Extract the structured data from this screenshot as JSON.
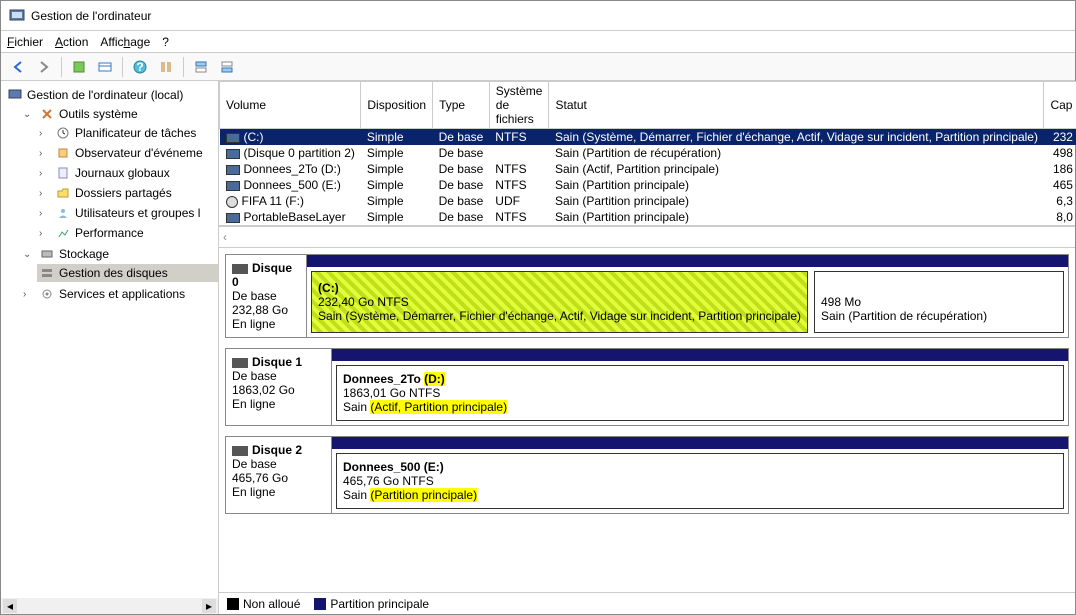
{
  "title": "Gestion de l'ordinateur",
  "menu": {
    "file": "Fichier",
    "action": "Action",
    "view": "Affichage",
    "help": "?"
  },
  "tree": {
    "root": "Gestion de l'ordinateur (local)",
    "sys": "Outils système",
    "sys_items": [
      "Planificateur de tâches",
      "Observateur d'événeme",
      "Journaux globaux",
      "Dossiers partagés",
      "Utilisateurs et groupes l",
      "Performance"
    ],
    "storage": "Stockage",
    "disks": "Gestion des disques",
    "services": "Services et applications"
  },
  "cols": {
    "volume": "Volume",
    "disposition": "Disposition",
    "type": "Type",
    "fs": "Système de fichiers",
    "status": "Statut",
    "cap": "Cap"
  },
  "rows": [
    {
      "name": "(C:)",
      "disp": "Simple",
      "type": "De base",
      "fs": "NTFS",
      "status": "Sain (Système, Démarrer, Fichier d'échange, Actif, Vidage sur incident, Partition principale)",
      "cap": "232"
    },
    {
      "name": "(Disque 0 partition 2)",
      "disp": "Simple",
      "type": "De base",
      "fs": "",
      "status": "Sain (Partition de récupération)",
      "cap": "498"
    },
    {
      "name": "Donnees_2To (D:)",
      "disp": "Simple",
      "type": "De base",
      "fs": "NTFS",
      "status": "Sain (Actif, Partition principale)",
      "cap": "186"
    },
    {
      "name": "Donnees_500 (E:)",
      "disp": "Simple",
      "type": "De base",
      "fs": "NTFS",
      "status": "Sain (Partition principale)",
      "cap": "465"
    },
    {
      "name": "FIFA 11 (F:)",
      "disp": "Simple",
      "type": "De base",
      "fs": "UDF",
      "status": "Sain (Partition principale)",
      "cap": "6,3"
    },
    {
      "name": "PortableBaseLayer",
      "disp": "Simple",
      "type": "De base",
      "fs": "NTFS",
      "status": "Sain (Partition principale)",
      "cap": "8,0"
    }
  ],
  "disk0": {
    "name": "Disque 0",
    "type": "De base",
    "size": "232,88 Go",
    "state": "En ligne",
    "p1_name": "(C:)",
    "p1_size": "232,40 Go NTFS",
    "p1_status": "Sain (Système, Démarrer, Fichier d'échange, Actif, Vidage sur incident, Partition principale)",
    "p2_size": "498 Mo",
    "p2_status": "Sain (Partition de récupération)"
  },
  "disk1": {
    "name": "Disque 1",
    "type": "De base",
    "size": "1863,02 Go",
    "state": "En ligne",
    "p1_name_a": "Donnees_2To ",
    "p1_name_b": "(D:)",
    "p1_size": "1863,01 Go NTFS",
    "p1_status_a": "Sain ",
    "p1_status_b": "(Actif, Partition principale)"
  },
  "disk2": {
    "name": "Disque 2",
    "type": "De base",
    "size": "465,76 Go",
    "state": "En ligne",
    "p1_name": "Donnees_500  (E:)",
    "p1_size": "465,76 Go NTFS",
    "p1_status_a": "Sain ",
    "p1_status_b": "(Partition principale)"
  },
  "legend": {
    "unalloc": "Non alloué",
    "primary": "Partition principale"
  }
}
